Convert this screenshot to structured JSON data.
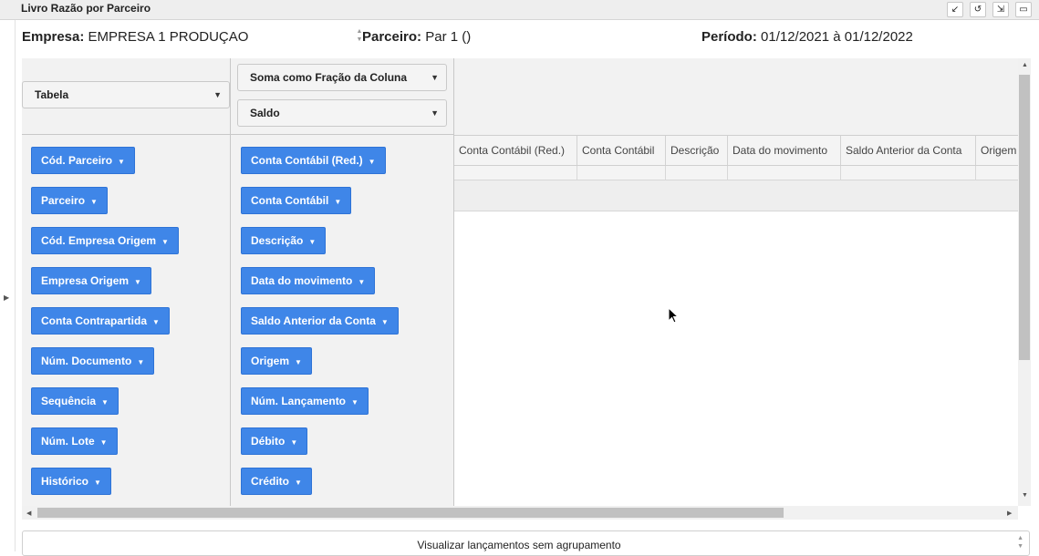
{
  "window": {
    "title": "Livro Razão por Parceiro",
    "buttons": [
      "↙",
      "↺",
      "⇲",
      "▭"
    ]
  },
  "info": {
    "empresa_label": "Empresa:",
    "empresa_value": "EMPRESA 1 PRODUÇAO",
    "parceiro_label": "Parceiro:",
    "parceiro_value": "Par 1 ()",
    "periodo_label": "Período:",
    "periodo_value": "01/12/2021 à 01/12/2022"
  },
  "pivot": {
    "renderer": "Tabela",
    "aggregator": "Soma como Fração da Coluna",
    "value_field": "Saldo",
    "unused_fields": [
      "Cód. Parceiro",
      "Parceiro",
      "Cód. Empresa Origem",
      "Empresa Origem",
      "Conta Contrapartida",
      "Núm. Documento",
      "Sequência",
      "Núm. Lote",
      "Histórico"
    ],
    "row_fields": [
      "Conta Contábil (Red.)",
      "Conta Contábil",
      "Descrição",
      "Data do movimento",
      "Saldo Anterior da Conta",
      "Origem",
      "Núm. Lançamento",
      "Débito",
      "Crédito"
    ]
  },
  "table": {
    "headers": [
      "Conta Contábil (Red.)",
      "Conta Contábil",
      "Descrição",
      "Data do movimento",
      "Saldo Anterior da Conta",
      "Origem"
    ]
  },
  "bottom": {
    "label": "Visualizar lançamentos sem agrupamento"
  }
}
